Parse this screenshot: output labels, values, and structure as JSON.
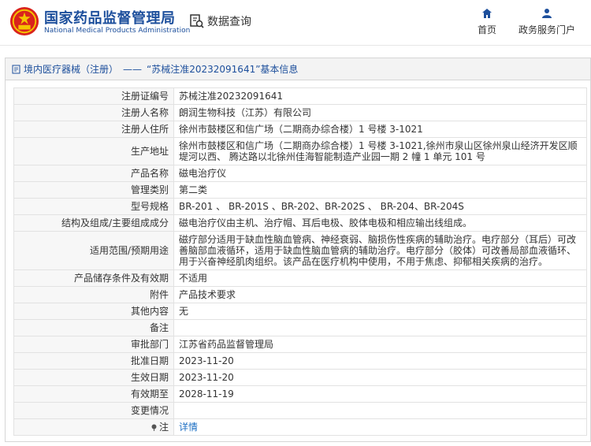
{
  "header": {
    "title_cn": "国家药品监督管理局",
    "title_en": "National Medical Products Administration",
    "search_label": "数据查询",
    "nav": [
      {
        "label": "首页",
        "icon": "home-icon"
      },
      {
        "label": "政务服务门户",
        "icon": "person-icon"
      }
    ],
    "brand_color": "#1d4f9c"
  },
  "breadcrumb": {
    "category": "境内医疗器械（注册）",
    "separator": "——",
    "record": "“苏械注准20232091641”基本信息"
  },
  "details": [
    {
      "label": "注册证编号",
      "value": "苏械注准20232091641"
    },
    {
      "label": "注册人名称",
      "value": "朗润生物科技（江苏）有限公司"
    },
    {
      "label": "注册人住所",
      "value": "徐州市鼓楼区和信广场（二期商办综合楼）1 号楼 3-1021"
    },
    {
      "label": "生产地址",
      "value": "徐州市鼓楼区和信广场（二期商办综合楼）1 号楼 3-1021,徐州市泉山区徐州泉山经济开发区顺堤河以西、 腾达路以北徐州佳海智能制造产业园一期 2 幢 1 单元 101 号"
    },
    {
      "label": "产品名称",
      "value": "磁电治疗仪"
    },
    {
      "label": "管理类别",
      "value": "第二类"
    },
    {
      "label": "型号规格",
      "value": "BR-201 、 BR-201S 、BR-202、BR-202S 、 BR-204、BR-204S"
    },
    {
      "label": "结构及组成/主要组成成分",
      "value": "磁电治疗仪由主机、治疗帽、耳后电极、胶体电极和相应输出线组成。"
    },
    {
      "label": "适用范围/预期用途",
      "value": "磁疗部分适用于缺血性脑血管病、神经衰弱、脑损伤性疾病的辅助治疗。电疗部分（耳后）可改善脑部血液循环，适用于缺血性脑血管病的辅助治疗。电疗部分（胶体）可改善局部血液循环、用于兴奋神经肌肉组织。该产品在医疗机构中使用，不用于焦虑、抑郁相关疾病的治疗。"
    },
    {
      "label": "产品储存条件及有效期",
      "value": "不适用"
    },
    {
      "label": "附件",
      "value": "产品技术要求"
    },
    {
      "label": "其他内容",
      "value": "无"
    },
    {
      "label": "备注",
      "value": ""
    },
    {
      "label": "审批部门",
      "value": "江苏省药品监督管理局"
    },
    {
      "label": "批准日期",
      "value": "2023-11-20"
    },
    {
      "label": "生效日期",
      "value": "2023-11-20"
    },
    {
      "label": "有效期至",
      "value": "2028-11-19"
    },
    {
      "label": "变更情况",
      "value": ""
    }
  ],
  "note": {
    "label": "注",
    "link": "详情",
    "icon": "pin-icon"
  }
}
